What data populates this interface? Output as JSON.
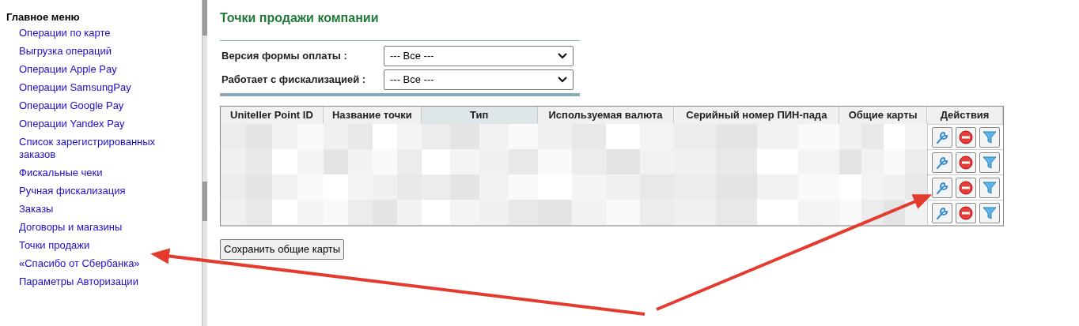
{
  "sidebar": {
    "title": "Главное меню",
    "items": [
      {
        "label": "Операции по карте"
      },
      {
        "label": "Выгрузка операций"
      },
      {
        "label": "Операции Apple Pay"
      },
      {
        "label": "Операции SamsungPay"
      },
      {
        "label": "Операции Google Pay"
      },
      {
        "label": "Операции Yandex Pay"
      },
      {
        "label": "Список зарегистрированных заказов"
      },
      {
        "label": "Фискальные чеки"
      },
      {
        "label": "Ручная фискализация"
      },
      {
        "label": "Заказы"
      },
      {
        "label": "Договоры и магазины"
      },
      {
        "label": "Точки продажи"
      },
      {
        "label": "«Спасибо от Сбербанка»"
      },
      {
        "label": "Параметры Авторизации"
      }
    ]
  },
  "page_title": "Точки продажи компании",
  "filters": [
    {
      "label": "Версия формы оплаты :",
      "value": "--- Все ---"
    },
    {
      "label": "Работает с фискализацией :",
      "value": "--- Все ---"
    }
  ],
  "table": {
    "columns": [
      "Uniteller Point ID",
      "Название точки",
      "Тип",
      "Используемая валюта",
      "Серийный номер ПИН-пада",
      "Общие карты",
      "Действия"
    ],
    "rows": [
      {
        "redacted": true
      },
      {
        "redacted": true
      },
      {
        "redacted": true
      },
      {
        "redacted": true
      }
    ]
  },
  "save_button": "Сохранить общие карты"
}
